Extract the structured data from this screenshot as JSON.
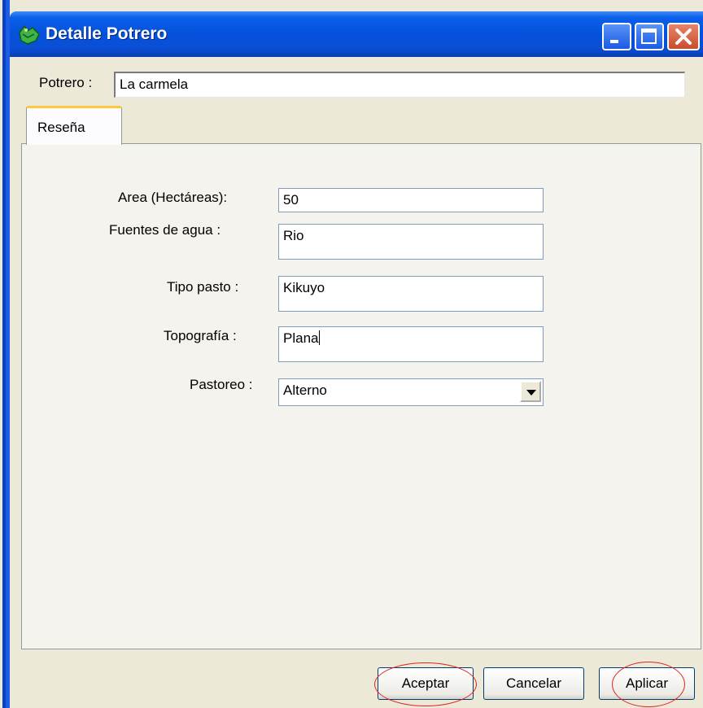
{
  "window": {
    "title": "Detalle Potrero",
    "controls": {
      "minimize": "minimize-icon",
      "maximize": "maximize-icon",
      "close": "close-icon"
    }
  },
  "potrero": {
    "label": "Potrero :",
    "value": "La carmela"
  },
  "tabs": [
    {
      "label": "Reseña"
    }
  ],
  "form": {
    "area": {
      "label": "Area (Hectáreas):",
      "value": "50"
    },
    "fuentes": {
      "label": "Fuentes de agua :",
      "value": "Rio"
    },
    "tipo_pasto": {
      "label": "Tipo pasto :",
      "value": "Kikuyo"
    },
    "topografia": {
      "label": "Topografía :",
      "value": "Plana"
    },
    "pastoreo": {
      "label": "Pastoreo :",
      "selected": "Alterno"
    }
  },
  "buttons": {
    "aceptar": "Aceptar",
    "cancelar": "Cancelar",
    "aplicar": "Aplicar"
  },
  "colors": {
    "titlebar": "#0551dc",
    "face": "#ece9d8",
    "annotation": "#e0231c",
    "tab_highlight": "#ffc83c"
  }
}
